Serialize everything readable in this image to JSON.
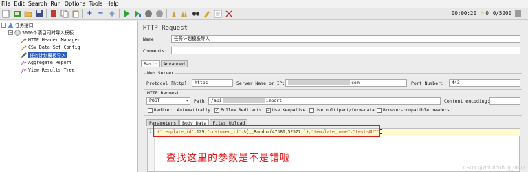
{
  "menubar": {
    "items": [
      "File",
      "Edit",
      "Search",
      "Run",
      "Options",
      "Tools",
      "Help"
    ]
  },
  "toolbar": {
    "icons": [
      "new-icon",
      "templates-icon",
      "open-icon",
      "save-icon",
      "cut-icon",
      "copy-icon",
      "paste-icon",
      "expand-icon",
      "collapse-icon",
      "toggle-icon",
      "start-icon",
      "start-no-pause-icon",
      "stop-icon",
      "shutdown-icon",
      "clear-icon",
      "clear-all-icon",
      "search-icon",
      "reset-search-icon",
      "function-helper-icon",
      "help-icon"
    ],
    "elapsed": "00:00:20",
    "warnings": "0",
    "threads": "0/5200"
  },
  "tree": {
    "root": "任务接口",
    "group": "5000个项目同时导入模板",
    "items": [
      "HTTP Header Manager",
      "CSV Data Set Config",
      "任务计划模板导入",
      "Aggregate Report",
      "View Results Tree"
    ]
  },
  "panel": {
    "title": "HTTP Request",
    "name_label": "Name:",
    "name_value": "任务计划模板导入",
    "comments_label": "Comments:",
    "comments_value": "",
    "tabs": [
      "Basic",
      "Advanced"
    ],
    "web_server_legend": "Web Server",
    "protocol_label": "Protocol [http]:",
    "protocol_value": "https",
    "server_label": "Server Name or IP:",
    "server_value_suffix": "com",
    "port_label": "Port Number:",
    "port_value": "443",
    "http_request_legend": "HTTP Request",
    "method": "POST",
    "path_label": "Path:",
    "path_prefix": "/api",
    "path_suffix": "import",
    "encoding_label": "Content encoding:",
    "encoding_value": "",
    "checkboxes": [
      {
        "label": "Redirect Automatically",
        "checked": false
      },
      {
        "label": "Follow Redirects",
        "checked": true
      },
      {
        "label": "Use KeepAlive",
        "checked": true
      },
      {
        "label": "Use multipart/form-data",
        "checked": false
      },
      {
        "label": "Browser-compatible headers",
        "checked": false
      }
    ],
    "body_tabs": [
      "Parameters",
      "Body Data",
      "Files Upload"
    ],
    "line_number": "1",
    "body": {
      "p1": "{\"template_id\"",
      "p2": ":129,",
      "p3": "\"customer_id\"",
      "p4": ":${__Random(47380,52577,)},",
      "p5": "\"template_name\"",
      "p6": ":",
      "p7": "\"test-AUT\""
    },
    "annotation": "查找这里的参数是不是错啦"
  },
  "watermark": "CSDN @doudoubug_0607"
}
